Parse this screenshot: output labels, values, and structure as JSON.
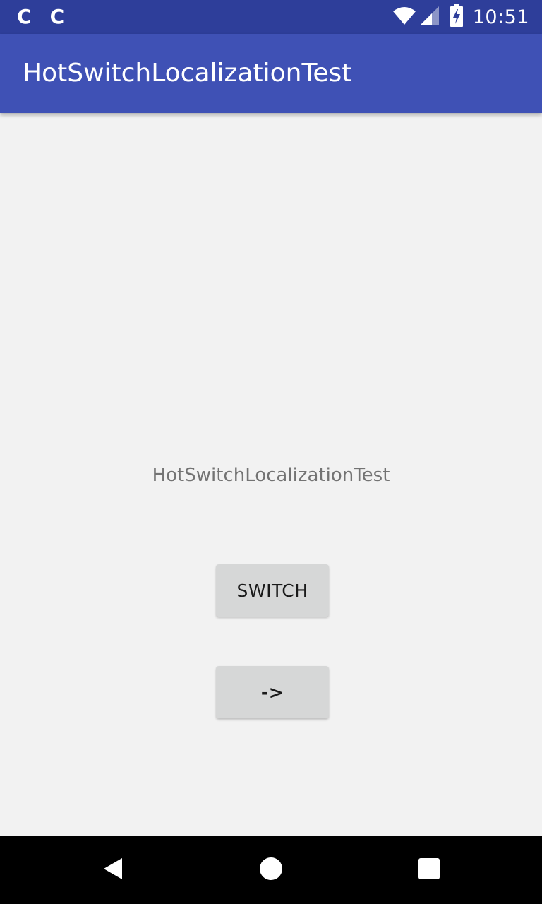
{
  "status_bar": {
    "notification_icons": [
      "C",
      "C"
    ],
    "time": "10:51",
    "icons": [
      "wifi-icon",
      "signal-icon",
      "battery-charging-icon"
    ]
  },
  "app_bar": {
    "title": "HotSwitchLocalizationTest"
  },
  "main": {
    "label": "HotSwitchLocalizationTest",
    "switch_button_label": "SWITCH",
    "next_button_label": "->"
  },
  "nav_bar": {
    "icons": [
      "back-icon",
      "home-icon",
      "recents-icon"
    ]
  },
  "colors": {
    "status_bar": "#2e3e9a",
    "app_bar": "#3f51b5",
    "background": "#f2f2f2",
    "button": "#d6d7d7"
  }
}
